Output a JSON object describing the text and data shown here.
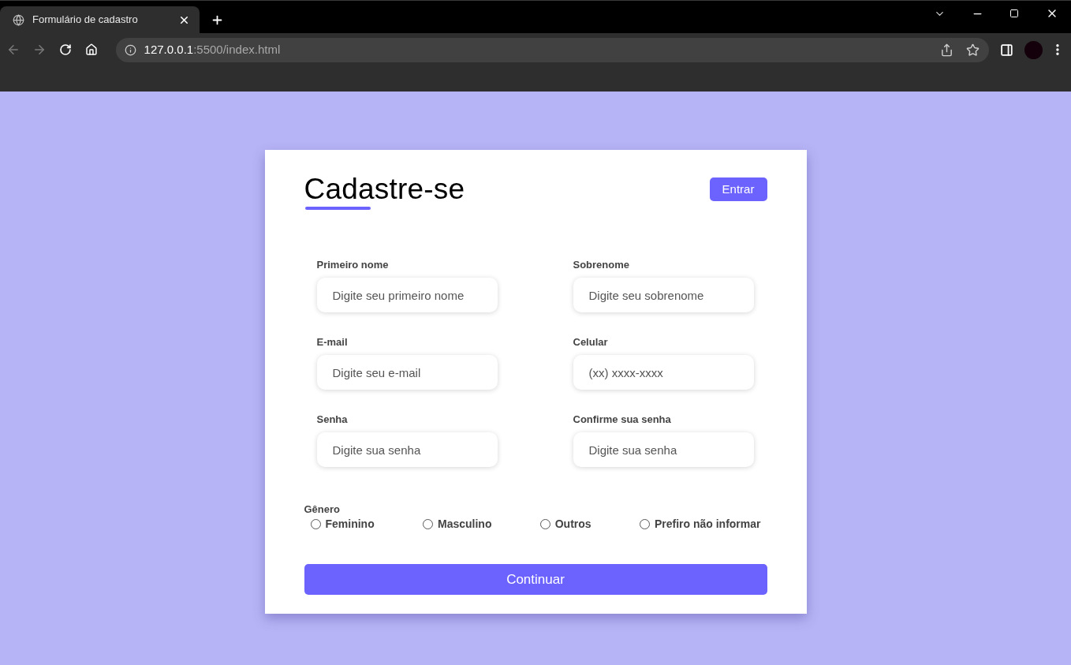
{
  "browser": {
    "tab": {
      "title": "Formulário de cadastro"
    },
    "address": {
      "host": "127.0.0.1",
      "path": ":5500/index.html"
    }
  },
  "form": {
    "title": "Cadastre-se",
    "login_button": "Entrar",
    "fields": [
      {
        "label": "Primeiro nome",
        "placeholder": "Digite seu primeiro nome"
      },
      {
        "label": "Sobrenome",
        "placeholder": "Digite seu sobrenome"
      },
      {
        "label": "E-mail",
        "placeholder": "Digite seu e-mail"
      },
      {
        "label": "Celular",
        "placeholder": "(xx) xxxx-xxxx"
      },
      {
        "label": "Senha",
        "placeholder": "Digite sua senha"
      },
      {
        "label": "Confirme sua senha",
        "placeholder": "Digite sua senha"
      }
    ],
    "gender": {
      "label": "Gênero",
      "options": [
        {
          "label": "Feminino",
          "selected": false
        },
        {
          "label": "Masculino",
          "selected": false
        },
        {
          "label": "Outros",
          "selected": false
        },
        {
          "label": "Prefiro não informar",
          "selected": false
        }
      ]
    },
    "submit_button": "Continuar"
  }
}
